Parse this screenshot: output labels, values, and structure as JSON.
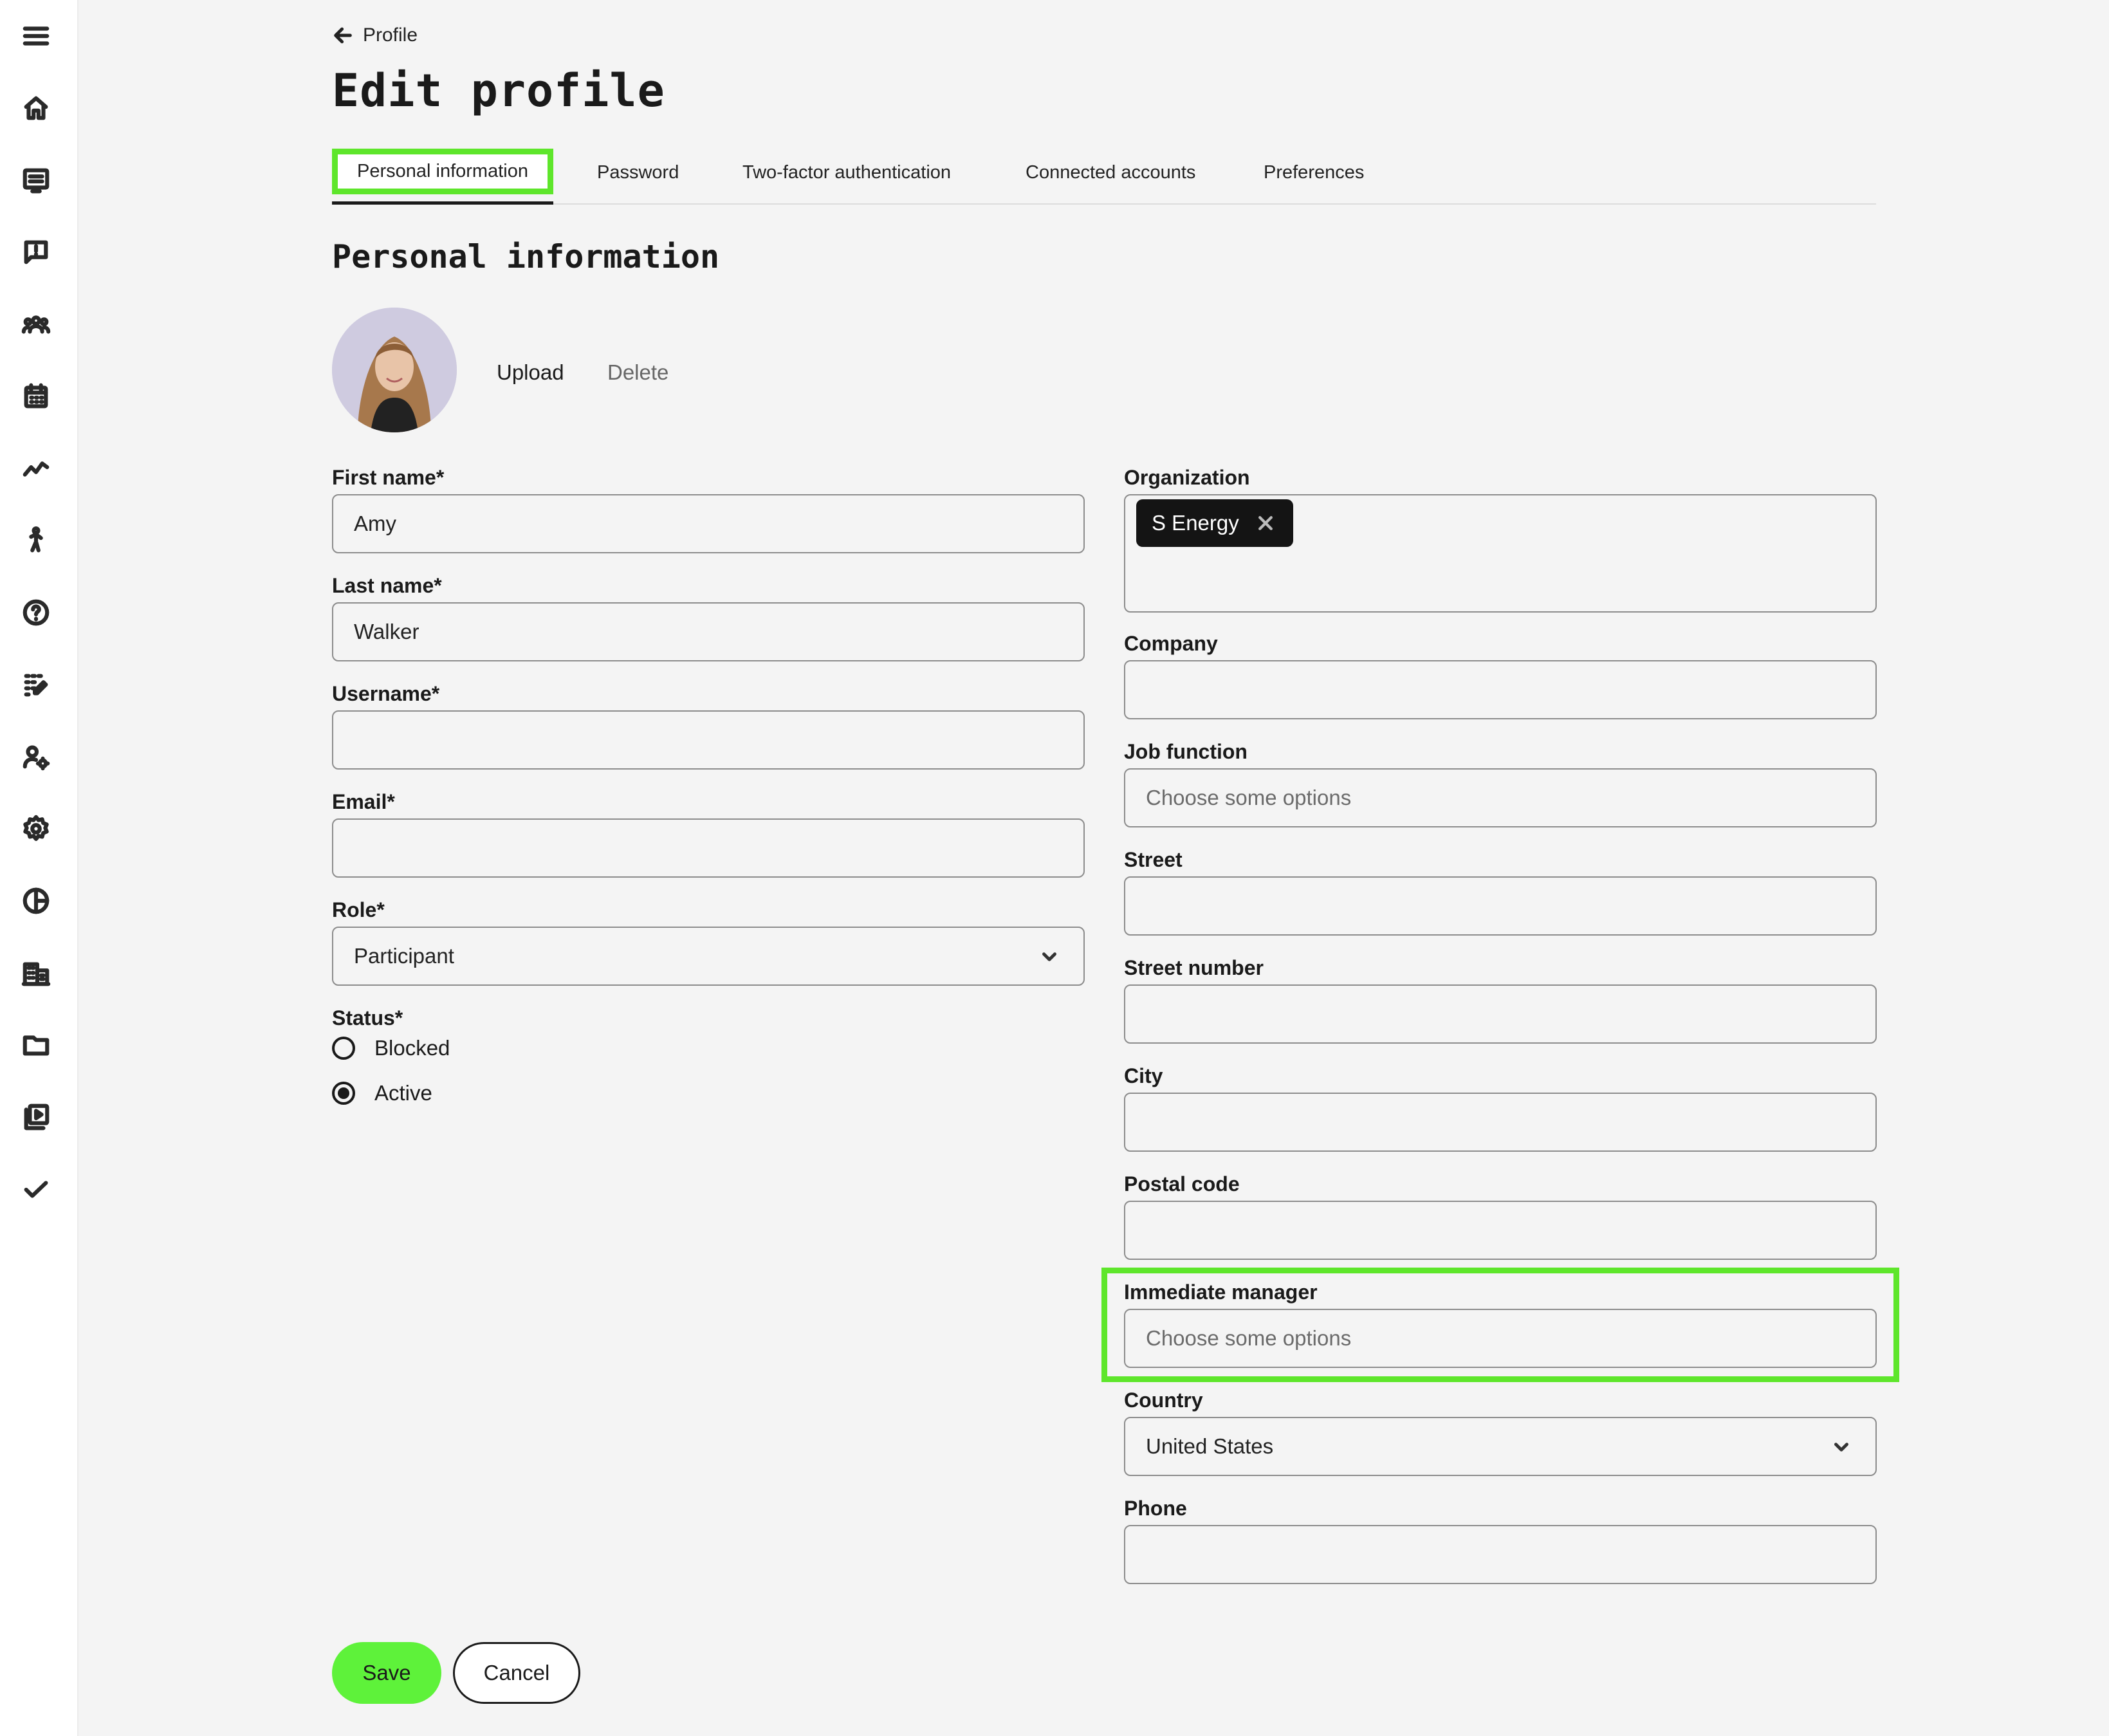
{
  "sidebar": {
    "icons": [
      "menu-icon",
      "home-icon",
      "list-icon",
      "feedback-icon",
      "groups-icon",
      "calendar-icon",
      "analytics-icon",
      "activity-icon",
      "help-icon",
      "apps-edit-icon",
      "user-settings-icon",
      "settings-icon",
      "pie-chart-icon",
      "building-icon",
      "folder-icon",
      "video-library-icon",
      "check-icon"
    ]
  },
  "header": {
    "back_label": "Profile",
    "title": "Edit profile"
  },
  "tabs": [
    {
      "label": "Personal information",
      "active": true
    },
    {
      "label": "Password",
      "active": false
    },
    {
      "label": "Two-factor authentication",
      "active": false
    },
    {
      "label": "Connected accounts",
      "active": false
    },
    {
      "label": "Preferences",
      "active": false
    }
  ],
  "section": {
    "title": "Personal information",
    "upload_label": "Upload",
    "delete_label": "Delete"
  },
  "form_left": {
    "first_name": {
      "label": "First name*",
      "value": "Amy"
    },
    "last_name": {
      "label": "Last name*",
      "value": "Walker"
    },
    "username": {
      "label": "Username*",
      "value": ""
    },
    "email": {
      "label": "Email*",
      "value": ""
    },
    "role": {
      "label": "Role*",
      "value": "Participant"
    },
    "status": {
      "label": "Status*",
      "options": [
        {
          "label": "Blocked",
          "selected": false
        },
        {
          "label": "Active",
          "selected": true
        }
      ]
    }
  },
  "form_right": {
    "organization": {
      "label": "Organization",
      "chip": "S Energy"
    },
    "company": {
      "label": "Company",
      "value": ""
    },
    "job_function": {
      "label": "Job function",
      "placeholder": "Choose some options"
    },
    "street": {
      "label": "Street",
      "value": ""
    },
    "street_number": {
      "label": "Street number",
      "value": ""
    },
    "city": {
      "label": "City",
      "value": ""
    },
    "postal_code": {
      "label": "Postal code",
      "value": ""
    },
    "immediate_manager": {
      "label": "Immediate manager",
      "placeholder": "Choose some options"
    },
    "country": {
      "label": "Country",
      "value": "United States"
    },
    "phone": {
      "label": "Phone",
      "value": ""
    }
  },
  "actions": {
    "save_label": "Save",
    "cancel_label": "Cancel"
  },
  "colors": {
    "accent": "#5ef23a",
    "highlight": "#5ee62b",
    "chip_bg": "#141414"
  }
}
